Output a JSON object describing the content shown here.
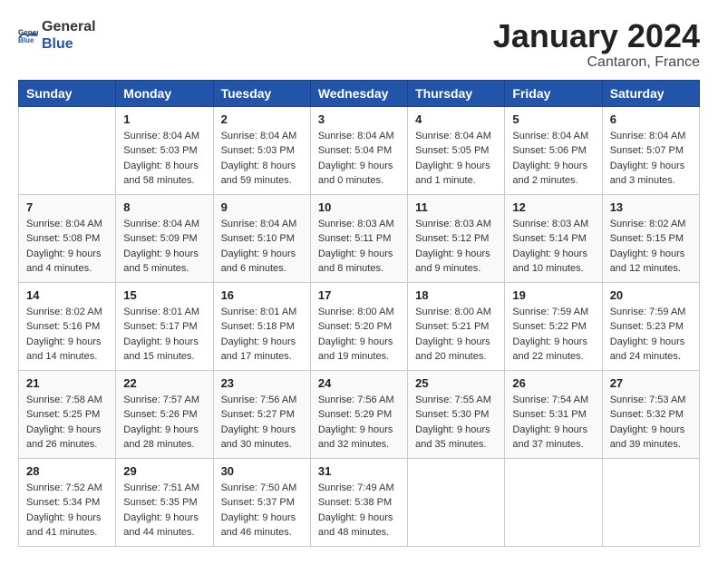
{
  "header": {
    "logo_general": "General",
    "logo_blue": "Blue",
    "month": "January 2024",
    "location": "Cantaron, France"
  },
  "weekdays": [
    "Sunday",
    "Monday",
    "Tuesday",
    "Wednesday",
    "Thursday",
    "Friday",
    "Saturday"
  ],
  "weeks": [
    [
      {
        "day": "",
        "sunrise": "",
        "sunset": "",
        "daylight": ""
      },
      {
        "day": "1",
        "sunrise": "Sunrise: 8:04 AM",
        "sunset": "Sunset: 5:03 PM",
        "daylight": "Daylight: 8 hours and 58 minutes."
      },
      {
        "day": "2",
        "sunrise": "Sunrise: 8:04 AM",
        "sunset": "Sunset: 5:03 PM",
        "daylight": "Daylight: 8 hours and 59 minutes."
      },
      {
        "day": "3",
        "sunrise": "Sunrise: 8:04 AM",
        "sunset": "Sunset: 5:04 PM",
        "daylight": "Daylight: 9 hours and 0 minutes."
      },
      {
        "day": "4",
        "sunrise": "Sunrise: 8:04 AM",
        "sunset": "Sunset: 5:05 PM",
        "daylight": "Daylight: 9 hours and 1 minute."
      },
      {
        "day": "5",
        "sunrise": "Sunrise: 8:04 AM",
        "sunset": "Sunset: 5:06 PM",
        "daylight": "Daylight: 9 hours and 2 minutes."
      },
      {
        "day": "6",
        "sunrise": "Sunrise: 8:04 AM",
        "sunset": "Sunset: 5:07 PM",
        "daylight": "Daylight: 9 hours and 3 minutes."
      }
    ],
    [
      {
        "day": "7",
        "sunrise": "Sunrise: 8:04 AM",
        "sunset": "Sunset: 5:08 PM",
        "daylight": "Daylight: 9 hours and 4 minutes."
      },
      {
        "day": "8",
        "sunrise": "Sunrise: 8:04 AM",
        "sunset": "Sunset: 5:09 PM",
        "daylight": "Daylight: 9 hours and 5 minutes."
      },
      {
        "day": "9",
        "sunrise": "Sunrise: 8:04 AM",
        "sunset": "Sunset: 5:10 PM",
        "daylight": "Daylight: 9 hours and 6 minutes."
      },
      {
        "day": "10",
        "sunrise": "Sunrise: 8:03 AM",
        "sunset": "Sunset: 5:11 PM",
        "daylight": "Daylight: 9 hours and 8 minutes."
      },
      {
        "day": "11",
        "sunrise": "Sunrise: 8:03 AM",
        "sunset": "Sunset: 5:12 PM",
        "daylight": "Daylight: 9 hours and 9 minutes."
      },
      {
        "day": "12",
        "sunrise": "Sunrise: 8:03 AM",
        "sunset": "Sunset: 5:14 PM",
        "daylight": "Daylight: 9 hours and 10 minutes."
      },
      {
        "day": "13",
        "sunrise": "Sunrise: 8:02 AM",
        "sunset": "Sunset: 5:15 PM",
        "daylight": "Daylight: 9 hours and 12 minutes."
      }
    ],
    [
      {
        "day": "14",
        "sunrise": "Sunrise: 8:02 AM",
        "sunset": "Sunset: 5:16 PM",
        "daylight": "Daylight: 9 hours and 14 minutes."
      },
      {
        "day": "15",
        "sunrise": "Sunrise: 8:01 AM",
        "sunset": "Sunset: 5:17 PM",
        "daylight": "Daylight: 9 hours and 15 minutes."
      },
      {
        "day": "16",
        "sunrise": "Sunrise: 8:01 AM",
        "sunset": "Sunset: 5:18 PM",
        "daylight": "Daylight: 9 hours and 17 minutes."
      },
      {
        "day": "17",
        "sunrise": "Sunrise: 8:00 AM",
        "sunset": "Sunset: 5:20 PM",
        "daylight": "Daylight: 9 hours and 19 minutes."
      },
      {
        "day": "18",
        "sunrise": "Sunrise: 8:00 AM",
        "sunset": "Sunset: 5:21 PM",
        "daylight": "Daylight: 9 hours and 20 minutes."
      },
      {
        "day": "19",
        "sunrise": "Sunrise: 7:59 AM",
        "sunset": "Sunset: 5:22 PM",
        "daylight": "Daylight: 9 hours and 22 minutes."
      },
      {
        "day": "20",
        "sunrise": "Sunrise: 7:59 AM",
        "sunset": "Sunset: 5:23 PM",
        "daylight": "Daylight: 9 hours and 24 minutes."
      }
    ],
    [
      {
        "day": "21",
        "sunrise": "Sunrise: 7:58 AM",
        "sunset": "Sunset: 5:25 PM",
        "daylight": "Daylight: 9 hours and 26 minutes."
      },
      {
        "day": "22",
        "sunrise": "Sunrise: 7:57 AM",
        "sunset": "Sunset: 5:26 PM",
        "daylight": "Daylight: 9 hours and 28 minutes."
      },
      {
        "day": "23",
        "sunrise": "Sunrise: 7:56 AM",
        "sunset": "Sunset: 5:27 PM",
        "daylight": "Daylight: 9 hours and 30 minutes."
      },
      {
        "day": "24",
        "sunrise": "Sunrise: 7:56 AM",
        "sunset": "Sunset: 5:29 PM",
        "daylight": "Daylight: 9 hours and 32 minutes."
      },
      {
        "day": "25",
        "sunrise": "Sunrise: 7:55 AM",
        "sunset": "Sunset: 5:30 PM",
        "daylight": "Daylight: 9 hours and 35 minutes."
      },
      {
        "day": "26",
        "sunrise": "Sunrise: 7:54 AM",
        "sunset": "Sunset: 5:31 PM",
        "daylight": "Daylight: 9 hours and 37 minutes."
      },
      {
        "day": "27",
        "sunrise": "Sunrise: 7:53 AM",
        "sunset": "Sunset: 5:32 PM",
        "daylight": "Daylight: 9 hours and 39 minutes."
      }
    ],
    [
      {
        "day": "28",
        "sunrise": "Sunrise: 7:52 AM",
        "sunset": "Sunset: 5:34 PM",
        "daylight": "Daylight: 9 hours and 41 minutes."
      },
      {
        "day": "29",
        "sunrise": "Sunrise: 7:51 AM",
        "sunset": "Sunset: 5:35 PM",
        "daylight": "Daylight: 9 hours and 44 minutes."
      },
      {
        "day": "30",
        "sunrise": "Sunrise: 7:50 AM",
        "sunset": "Sunset: 5:37 PM",
        "daylight": "Daylight: 9 hours and 46 minutes."
      },
      {
        "day": "31",
        "sunrise": "Sunrise: 7:49 AM",
        "sunset": "Sunset: 5:38 PM",
        "daylight": "Daylight: 9 hours and 48 minutes."
      },
      {
        "day": "",
        "sunrise": "",
        "sunset": "",
        "daylight": ""
      },
      {
        "day": "",
        "sunrise": "",
        "sunset": "",
        "daylight": ""
      },
      {
        "day": "",
        "sunrise": "",
        "sunset": "",
        "daylight": ""
      }
    ]
  ]
}
